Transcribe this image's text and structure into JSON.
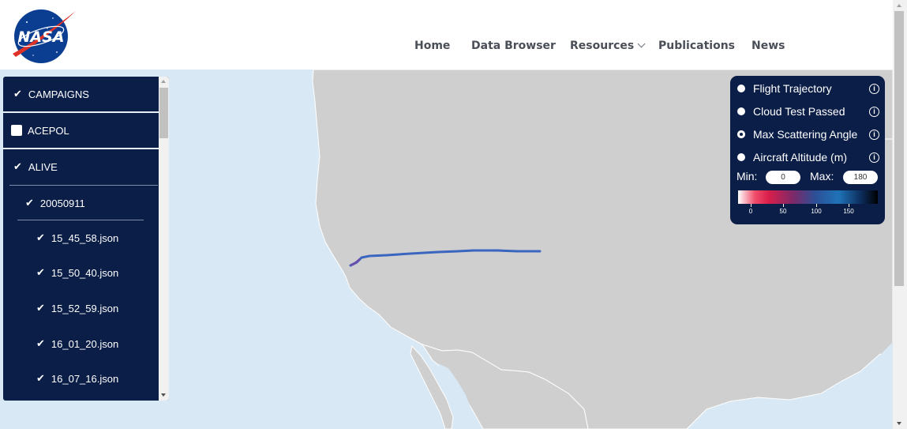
{
  "nav": {
    "home": "Home",
    "data_browser": "Data Browser",
    "resources": "Resources",
    "publications": "Publications",
    "news": "News"
  },
  "logo": {
    "text": "NASA"
  },
  "sidebar": {
    "campaigns_label": "CAMPAIGNS",
    "acepol_label": "ACEPOL",
    "alive_label": "ALIVE",
    "date_label": "20050911",
    "files": [
      "15_45_58.json",
      "15_50_40.json",
      "15_52_59.json",
      "16_01_20.json",
      "16_07_16.json"
    ]
  },
  "panel": {
    "options": [
      "Flight Trajectory",
      "Cloud Test Passed",
      "Max Scattering Angle",
      "Aircraft Altitude (m)"
    ],
    "selected_option": "Max Scattering Angle",
    "info_glyph": "i",
    "min_label": "Min:",
    "min_value": "0",
    "max_label": "Max:",
    "max_value": "180",
    "colorbar_ticks": [
      "0",
      "50",
      "100",
      "150"
    ]
  },
  "colors": {
    "panel_bg": "#0b1e48",
    "map_water": "#d8e8f4",
    "map_land": "#cfcfcf",
    "trajectory": "#3a66bf"
  },
  "icons": [
    "nasa-logo",
    "checkmark-icon",
    "checkbox-icon",
    "chevron-down-icon",
    "info-icon",
    "scroll-up-icon",
    "scroll-down-icon"
  ]
}
